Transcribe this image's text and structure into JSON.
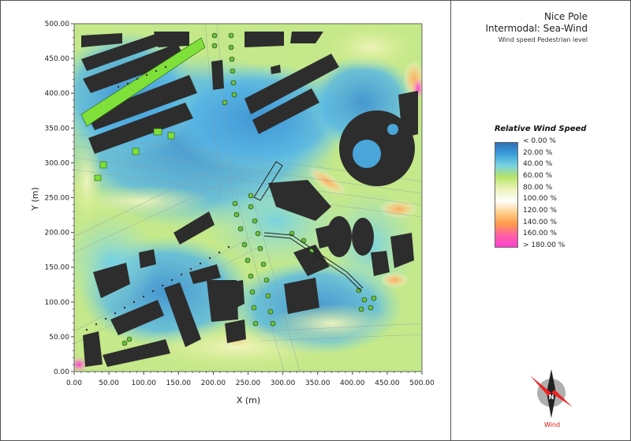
{
  "header": {
    "title_line1": "Nice Pole",
    "title_line2": "Intermodal: Sea-Wind",
    "subtitle": "Wind speed Pedestrian level"
  },
  "legend": {
    "title": "Relative Wind Speed",
    "entries": [
      "< 0.00 %",
      "20.00  %",
      "40.00  %",
      "60.00  %",
      "80.00  %",
      "100.00  %",
      "120.00  %",
      "140.00  %",
      "160.00  %",
      "> 180.00 %"
    ],
    "colors": [
      "#2f6fb5",
      "#3aa0dc",
      "#7ad3e0",
      "#b7e46a",
      "#ecf2b8",
      "#ffffff",
      "#ffd08a",
      "#ff9a4a",
      "#ff5fa8",
      "#ff3fcf"
    ]
  },
  "compass": {
    "label": "Wind",
    "letter": "N"
  },
  "chart_data": {
    "type": "heatmap",
    "title": "",
    "xlabel": "X (m)",
    "ylabel": "Y (m)",
    "xlim": [
      0,
      500
    ],
    "ylim": [
      0,
      500
    ],
    "x_ticks": [
      "0.00",
      "50.00",
      "100.00",
      "150.00",
      "200.00",
      "250.00",
      "300.00",
      "350.00",
      "400.00",
      "450.00",
      "500.00"
    ],
    "y_ticks": [
      "0.00",
      "50.00",
      "100.00",
      "150.00",
      "200.00",
      "250.00",
      "300.00",
      "350.00",
      "400.00",
      "450.00",
      "500.00"
    ],
    "grid": false,
    "colormap": "relative wind speed, 0 to 180 %"
  }
}
